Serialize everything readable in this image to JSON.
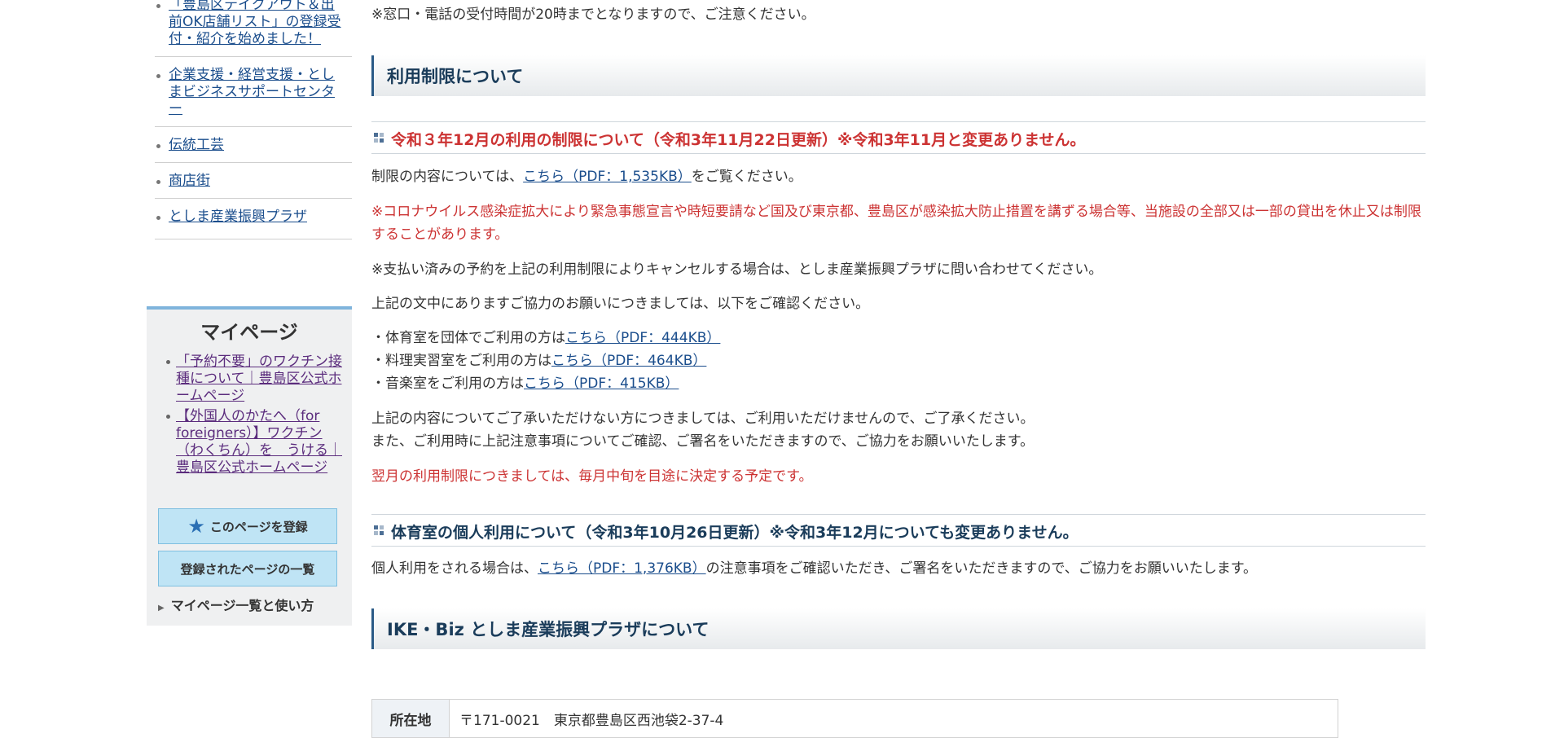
{
  "sidebar": {
    "links": [
      "「豊島区テイクアウト＆出前OK店舗リスト」の登録受付・紹介を始めました！",
      "企業支援・経営支援・としまビジネスサポートセンター",
      "伝統工芸",
      "商店街",
      "としま産業振興プラザ"
    ]
  },
  "mypage": {
    "title": "マイページ",
    "links": [
      "「予約不要」のワクチン接種について｜豊島区公式ホームページ",
      "【外国人のかたへ（for foreigners）】ワクチン（わくちん）を　うける｜豊島区公式ホームページ"
    ],
    "register_button": "このページを登録",
    "list_button": "登録されたページの一覧",
    "howto_link": "マイページ一覧と使い方"
  },
  "main": {
    "top_notice": "※窓口・電話の受付時間が20時までとなりますので、ご注意ください。",
    "section_title": "利用制限について",
    "sub1_title": "令和３年12月の利用の制限について（令和3年11月22日更新）※令和3年11月と変更ありません。",
    "p1_before": "制限の内容については、",
    "p1_link": "こちら（PDF：1,535KB）",
    "p1_after": "をご覧ください。",
    "red_notice": "※コロナウイルス感染症拡大により緊急事態宣言や時短要請など国及び東京都、豊島区が感染拡大防止措置を講ずる場合等、当施設の全部又は一部の貸出を休止又は制限することがあります。",
    "cancel_notice": "※支払い済みの予約を上記の利用制限によりキャンセルする場合は、としま産業振興プラザに問い合わせてください。",
    "confirm_text": "上記の文中にありますご協力のお願いにつきましては、以下をご確認ください。",
    "list_items": [
      {
        "prefix": "・体育室を団体でご利用の方は",
        "link": "こちら（PDF：444KB）"
      },
      {
        "prefix": "・料理実習室をご利用の方は",
        "link": "こちら（PDF：464KB）"
      },
      {
        "prefix": "・音楽室をご利用の方は",
        "link": "こちら（PDF：415KB）"
      }
    ],
    "accept_line1": "上記の内容についてご了承いただけない方につきましては、ご利用いただけませんので、ご了承ください。",
    "accept_line2": "また、ご利用時に上記注意事項についてご確認、ご署名をいただきますので、ご協力をお願いいたします。",
    "next_month": "翌月の利用制限につきましては、毎月中旬を目途に決定する予定です。",
    "sub2_title": "体育室の個人利用について（令和3年10月26日更新）※令和3年12月についても変更ありません。",
    "p2_before": "個人利用をされる場合は、",
    "p2_link": "こちら（PDF：1,376KB）",
    "p2_after": "の注意事項をご確認いただき、ご署名をいただきますので、ご協力をお願いいたします。",
    "section2_title": "IKE・Biz としま産業振興プラザについて",
    "info_label": "所在地",
    "info_value": "〒171-0021　東京都豊島区西池袋2-37-4"
  },
  "colors": {
    "link": "#1a4d8c",
    "visited_link": "#5b2c7d",
    "notice_red": "#cc3333",
    "heading_border": "#2a5a86",
    "sidebar_accent": "#7fb4dc"
  }
}
